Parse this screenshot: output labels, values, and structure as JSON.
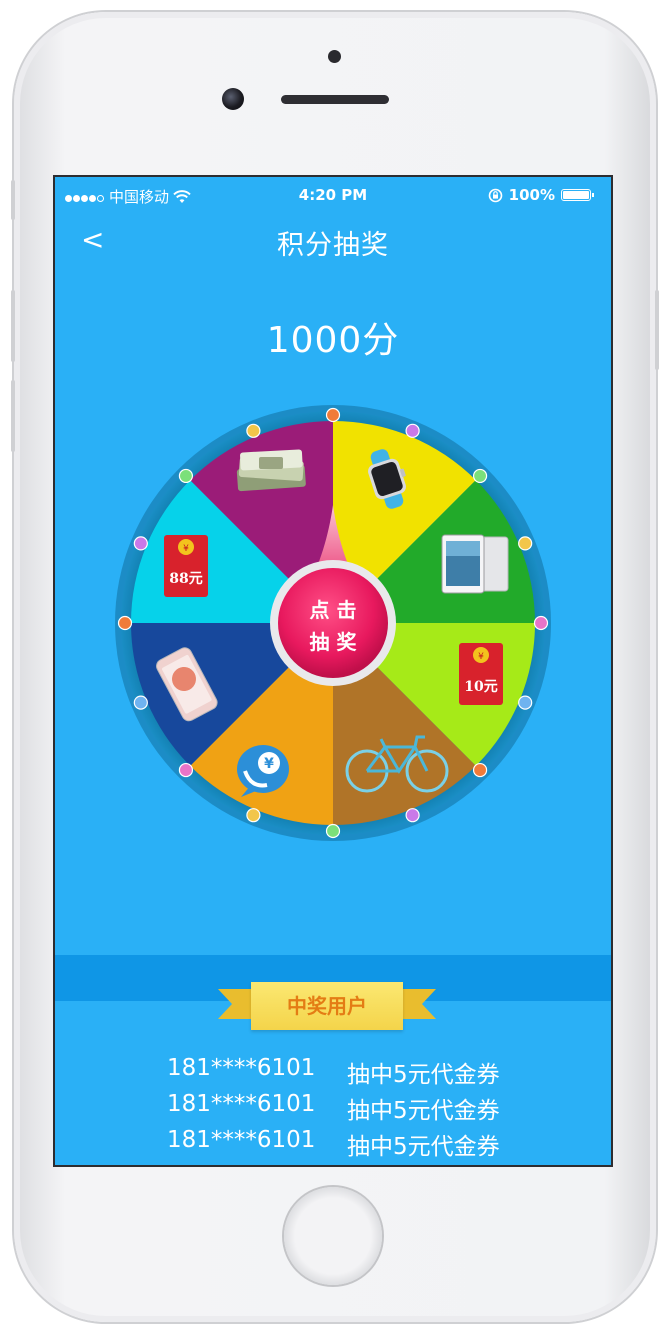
{
  "status_bar": {
    "carrier": "中国移动",
    "time": "4:20 PM",
    "battery": "100%"
  },
  "nav": {
    "back_icon": "<",
    "title": "积分抽奖"
  },
  "points": "1000分",
  "wheel": {
    "button_line1": "点 击",
    "button_line2": "抽 奖",
    "segments": [
      {
        "prize": "apple-watch",
        "color": "#f1e200"
      },
      {
        "prize": "ipad",
        "color": "#22aa2a"
      },
      {
        "prize": "red-envelope-10",
        "label": "10元",
        "color": "#a6ea18"
      },
      {
        "prize": "bicycle",
        "color": "#b07428"
      },
      {
        "prize": "phone-credit",
        "color": "#f0a214"
      },
      {
        "prize": "iphone",
        "color": "#17489c"
      },
      {
        "prize": "red-envelope-88",
        "label": "88元",
        "color": "#06d2ea"
      },
      {
        "prize": "cash",
        "color": "#9b1c78"
      }
    ]
  },
  "winners": {
    "title": "中奖用户",
    "rows": [
      {
        "phone": "181****6101",
        "prize": "抽中5元代金券"
      },
      {
        "phone": "181****6101",
        "prize": "抽中5元代金券"
      },
      {
        "phone": "181****6101",
        "prize": "抽中5元代金券"
      }
    ]
  },
  "colors": {
    "screen_bg": "#2ab0f6",
    "band": "#0f96e6",
    "button": "#e8195e",
    "ribbon": "#f4d44a",
    "ribbon_text": "#e47c14"
  }
}
